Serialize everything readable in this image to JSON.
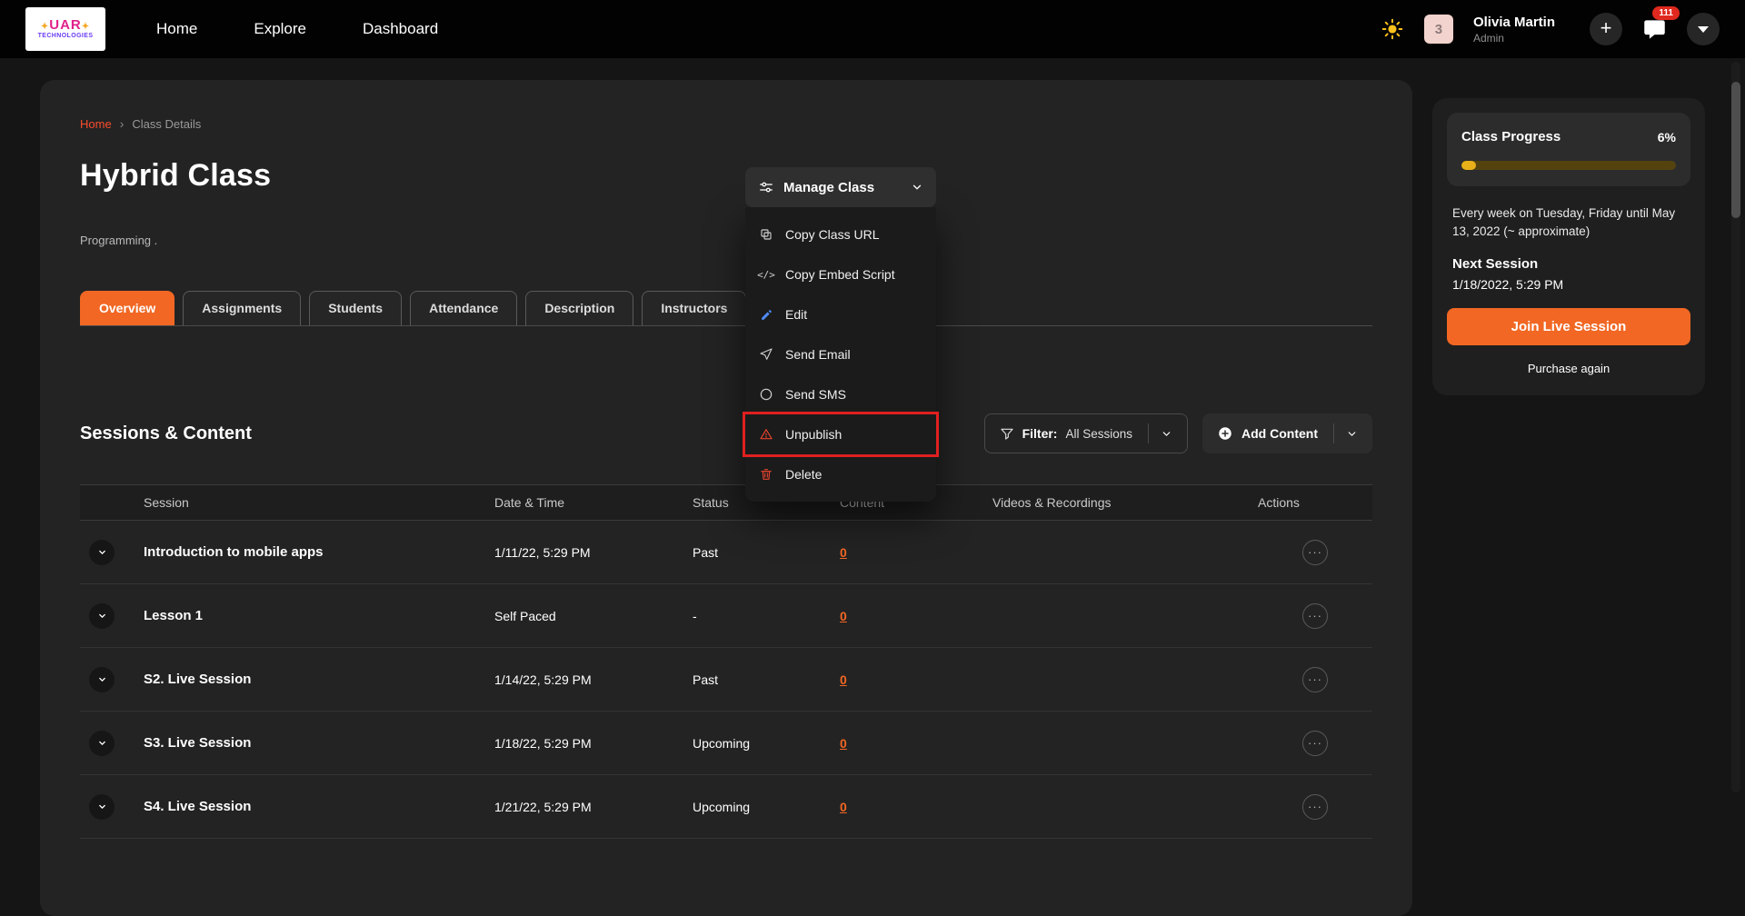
{
  "colors": {
    "accent_orange": "#f16723",
    "highlight_red": "#e02020",
    "progress_fill": "#e8b019",
    "badge_red": "#e0281e",
    "breadcrumb_link": "#fb4d2c"
  },
  "navbar": {
    "logo": {
      "star": "✦",
      "name": "UAR",
      "subtitle": "TECHNOLOGIES"
    },
    "links": [
      "Home",
      "Explore",
      "Dashboard"
    ],
    "user": {
      "name": "Olivia Martin",
      "role": "Admin",
      "avatar_label": "3"
    },
    "messages_badge": "111",
    "icons": {
      "theme": "sun-icon",
      "add": "plus-icon",
      "messages": "chat-bubble-icon",
      "menu": "caret-down-icon"
    }
  },
  "breadcrumb": {
    "home": "Home",
    "separator": "›",
    "current": "Class Details"
  },
  "class_header": {
    "title": "Hybrid Class",
    "category": "Programming ."
  },
  "tabs": [
    {
      "label": "Overview",
      "active": true
    },
    {
      "label": "Assignments",
      "active": false
    },
    {
      "label": "Students",
      "active": false
    },
    {
      "label": "Attendance",
      "active": false
    },
    {
      "label": "Description",
      "active": false
    },
    {
      "label": "Instructors",
      "active": false
    }
  ],
  "manage_menu": {
    "button_label": "Manage Class",
    "button_icon": "sliders-icon",
    "chevron_icon": "chevron-down-icon",
    "items": [
      {
        "label": "Copy Class URL",
        "icon": "copy-icon",
        "highlighted": false
      },
      {
        "label": "Copy Embed Script",
        "icon": "code-icon",
        "highlighted": false
      },
      {
        "label": "Edit",
        "icon": "pencil-icon",
        "highlighted": false
      },
      {
        "label": "Send Email",
        "icon": "send-icon",
        "highlighted": false
      },
      {
        "label": "Send SMS",
        "icon": "sms-bubble-icon",
        "highlighted": false
      },
      {
        "label": "Unpublish",
        "icon": "warning-icon",
        "highlighted": true
      },
      {
        "label": "Delete",
        "icon": "trash-icon",
        "highlighted": false
      }
    ]
  },
  "sessions_section": {
    "title": "Sessions & Content",
    "filter_label": "Filter:",
    "filter_value": "All Sessions",
    "filter_icon": "funnel-icon",
    "add_label": "Add Content",
    "add_icon": "plus-circle-icon"
  },
  "table": {
    "columns": [
      "Session",
      "Date & Time",
      "Status",
      "Content",
      "Videos & Recordings",
      "Actions"
    ],
    "row_icons": {
      "expand": "chevron-down-icon",
      "actions": "ellipsis-icon"
    },
    "ellipsis_glyph": "···",
    "rows": [
      {
        "session": "Introduction to mobile apps",
        "datetime": "1/11/22, 5:29 PM",
        "status": "Past",
        "content": "0"
      },
      {
        "session": "Lesson 1",
        "datetime": "Self Paced",
        "status": "-",
        "content": "0"
      },
      {
        "session": "S2. Live Session",
        "datetime": "1/14/22, 5:29 PM",
        "status": "Past",
        "content": "0"
      },
      {
        "session": "S3. Live Session",
        "datetime": "1/18/22, 5:29 PM",
        "status": "Upcoming",
        "content": "0"
      },
      {
        "session": "S4. Live Session",
        "datetime": "1/21/22, 5:29 PM",
        "status": "Upcoming",
        "content": "0"
      }
    ]
  },
  "progress_card": {
    "title": "Class Progress",
    "percent": "6%",
    "percent_value": 6,
    "schedule": "Every week on Tuesday, Friday until May 13, 2022 (~ approximate)",
    "next_session_label": "Next Session",
    "next_session_value": "1/18/2022, 5:29 PM",
    "join_button": "Join Live Session",
    "purchase_link": "Purchase again"
  }
}
